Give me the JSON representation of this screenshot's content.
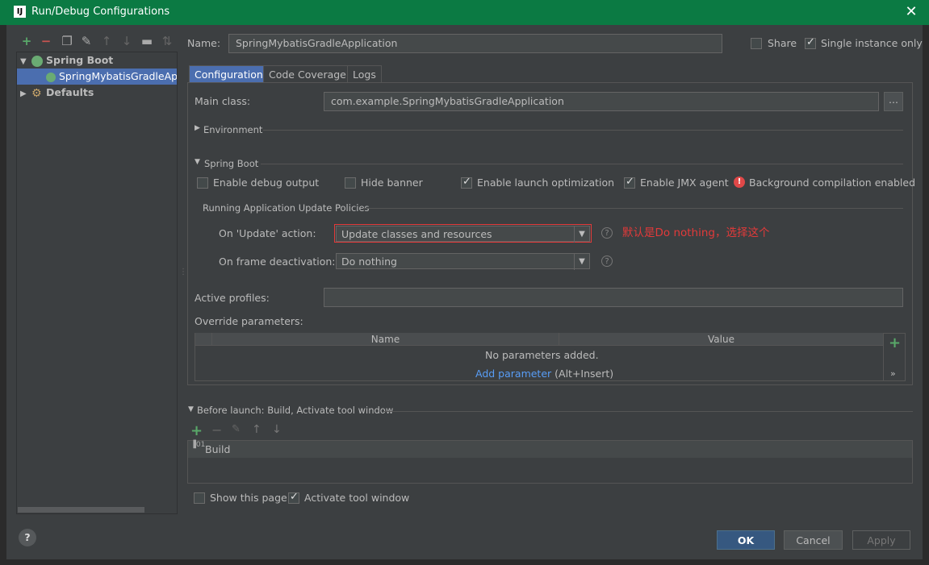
{
  "window": {
    "title": "Run/Debug Configurations",
    "app_icon": "IJ"
  },
  "toolbar": {
    "icons": [
      "add-icon",
      "remove-icon",
      "copy-icon",
      "wrench-icon",
      "move-up-icon",
      "move-down-icon",
      "folder-icon",
      "sort-icon"
    ]
  },
  "tree": {
    "items": [
      {
        "label": "Spring Boot",
        "expanded": true
      },
      {
        "label": "SpringMybatisGradleApplication",
        "selected": true
      },
      {
        "label": "Defaults",
        "expanded": false
      }
    ]
  },
  "name_field": {
    "label": "Name:",
    "value": "SpringMybatisGradleApplication"
  },
  "share": {
    "label": "Share",
    "checked": false
  },
  "single_instance": {
    "label": "Single instance only",
    "checked": true
  },
  "tabs": [
    "Configuration",
    "Code Coverage",
    "Logs"
  ],
  "config": {
    "main_class_label": "Main class:",
    "main_class_value": "com.example.SpringMybatisGradleApplication",
    "browse": "...",
    "environment": "Environment",
    "spring_boot_section": "Spring Boot",
    "debug_output": "Enable debug output",
    "hide_banner": "Hide banner",
    "launch_opt": "Enable launch optimization",
    "jmx": "Enable JMX agent",
    "bg_compile": "Background compilation enabled",
    "policies_title": "Running Application Update Policies",
    "update_action_label": "On 'Update' action:",
    "update_action_value": "Update classes and resources",
    "frame_deact_label": "On frame deactivation:",
    "frame_deact_value": "Do nothing",
    "annotation": "默认是Do nothing，选择这个",
    "active_profiles_label": "Active profiles:",
    "override_label": "Override parameters:",
    "col_name": "Name",
    "col_value": "Value",
    "no_params": "No parameters added.",
    "add_param": "Add parameter",
    "add_param_hint": "(Alt+Insert)"
  },
  "before_launch": {
    "title": "Before launch: Build, Activate tool window",
    "item": "Build"
  },
  "footer": {
    "show_page": "Show this page",
    "activate_tool": "Activate tool window",
    "ok": "OK",
    "cancel": "Cancel",
    "apply": "Apply"
  },
  "colors": {
    "titlebar": "#0b7a43",
    "selection": "#4b6eaf",
    "annotation": "#e23a3a",
    "add": "#59a869"
  }
}
